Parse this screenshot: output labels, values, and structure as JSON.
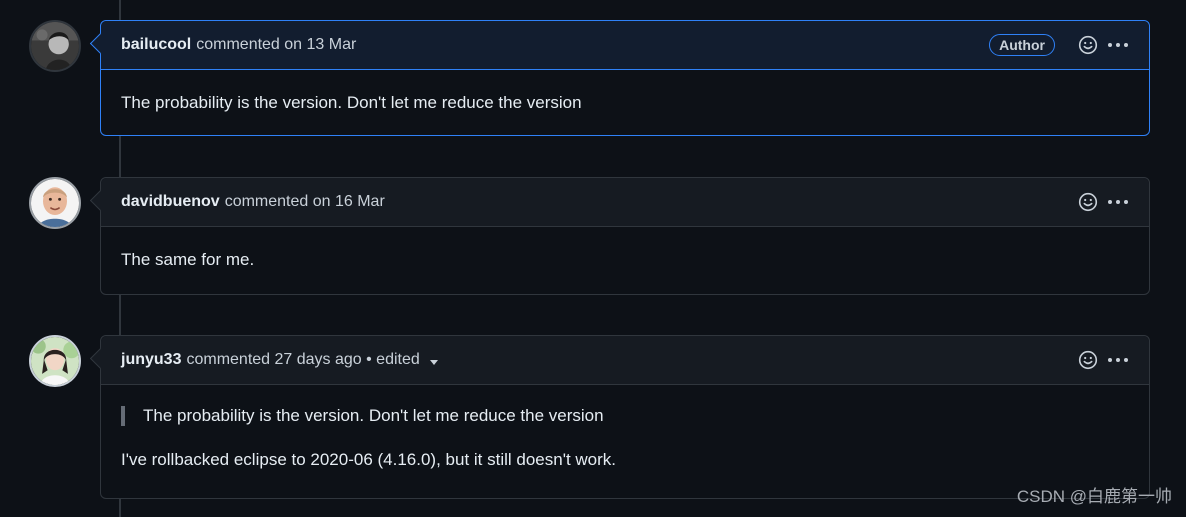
{
  "comments": [
    {
      "username": "bailucool",
      "meta": "commented on 13 Mar",
      "badge": "Author",
      "body": "The probability is the version. Don't let me reduce the version"
    },
    {
      "username": "davidbuenov",
      "meta": "commented on 16 Mar",
      "body": "The same for me."
    },
    {
      "username": "junyu33",
      "meta": "commented 27 days ago • edited",
      "quote": "The probability is the version. Don't let me reduce the version",
      "body": "I've rollbacked eclipse to 2020-06 (4.16.0), but it still doesn't work."
    }
  ],
  "icons": {
    "reaction": "smiley-icon",
    "menu": "kebab-horizontal-icon",
    "edited_dropdown": "caret-down-icon"
  },
  "colors": {
    "background": "#0d1117",
    "header": "#161b22",
    "author_header": "#121d2f",
    "border": "#30363d",
    "accent": "#2f81f7"
  },
  "watermark": "CSDN @白鹿第一帅"
}
